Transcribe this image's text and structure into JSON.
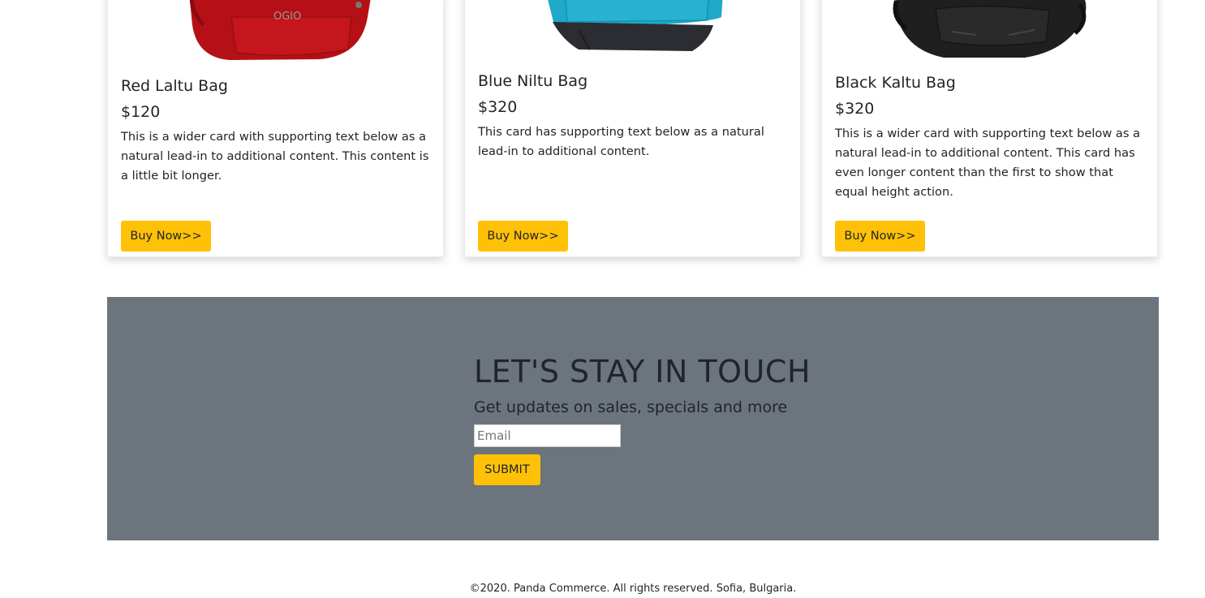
{
  "products": [
    {
      "title": "Red Laltu Bag",
      "price": "$120",
      "text": "This is a wider card with supporting text below as a natural lead-in to additional content. This content is a little bit longer.",
      "button": "Buy Now>>",
      "image_icon": "red-bag-image",
      "color": "#c0141a"
    },
    {
      "title": "Blue Niltu Bag",
      "price": "$320",
      "text": "This card has supporting text below as a natural lead-in to additional content.",
      "button": "Buy Now>>",
      "image_icon": "blue-bag-image",
      "color": "#1aa7c9"
    },
    {
      "title": "Black Kaltu Bag",
      "price": "$320",
      "text": "This is a wider card with supporting text below as a natural lead-in to additional content. This card has even longer content than the first to show that equal height action.",
      "button": "Buy Now>>",
      "image_icon": "black-bag-image",
      "color": "#1e1e1e"
    }
  ],
  "newsletter": {
    "title": "LET'S STAY IN TOUCH",
    "subtitle": "Get updates on sales, specials and more",
    "email_placeholder": "Email",
    "submit_label": "SUBMIT",
    "background": "#6c757d",
    "accent": "#ffc107"
  },
  "footer": {
    "text": "©2020. Panda Commerce. All rights reserved. Sofia, Bulgaria."
  },
  "bag_logo_text": "OGIO"
}
